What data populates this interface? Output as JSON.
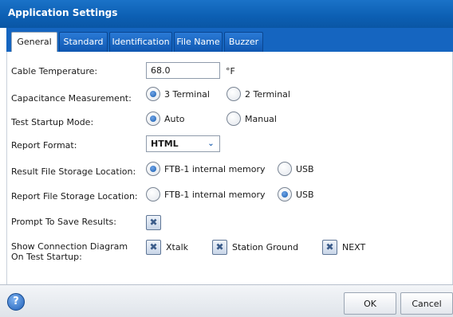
{
  "window": {
    "title": "Application Settings"
  },
  "tabs": [
    {
      "label": "General",
      "active": true
    },
    {
      "label": "Standard",
      "active": false
    },
    {
      "label": "Identification",
      "active": false
    },
    {
      "label": "File Name",
      "active": false
    },
    {
      "label": "Buzzer",
      "active": false
    }
  ],
  "cable_temperature": {
    "label": "Cable Temperature:",
    "value": "68.0",
    "unit": "°F"
  },
  "capacitance": {
    "label": "Capacitance Measurement:",
    "option1": "3 Terminal",
    "option2": "2 Terminal",
    "selected": "3 Terminal"
  },
  "startup_mode": {
    "label": "Test Startup Mode:",
    "option1": "Auto",
    "option2": "Manual",
    "selected": "Auto"
  },
  "report_format": {
    "label": "Report Format:",
    "value": "HTML"
  },
  "result_storage": {
    "label": "Result File Storage Location:",
    "option1": "FTB-1 internal memory",
    "option2": "USB",
    "selected": "FTB-1 internal memory"
  },
  "report_storage": {
    "label": "Report File Storage Location:",
    "option1": "FTB-1 internal memory",
    "option2": "USB",
    "selected": "USB"
  },
  "prompt_save": {
    "label": "Prompt To Save Results:",
    "checked": true
  },
  "connection_diagram": {
    "label_line1": "Show Connection Diagram",
    "label_line2": "On Test Startup:",
    "options": [
      {
        "label": "Xtalk",
        "checked": true
      },
      {
        "label": "Station Ground",
        "checked": true
      },
      {
        "label": "NEXT",
        "checked": true
      }
    ]
  },
  "footer": {
    "help_icon": "?",
    "ok_label": "OK",
    "cancel_label": "Cancel"
  },
  "icons": {
    "check_glyph": "✖",
    "dropdown_glyph": "⌄"
  }
}
